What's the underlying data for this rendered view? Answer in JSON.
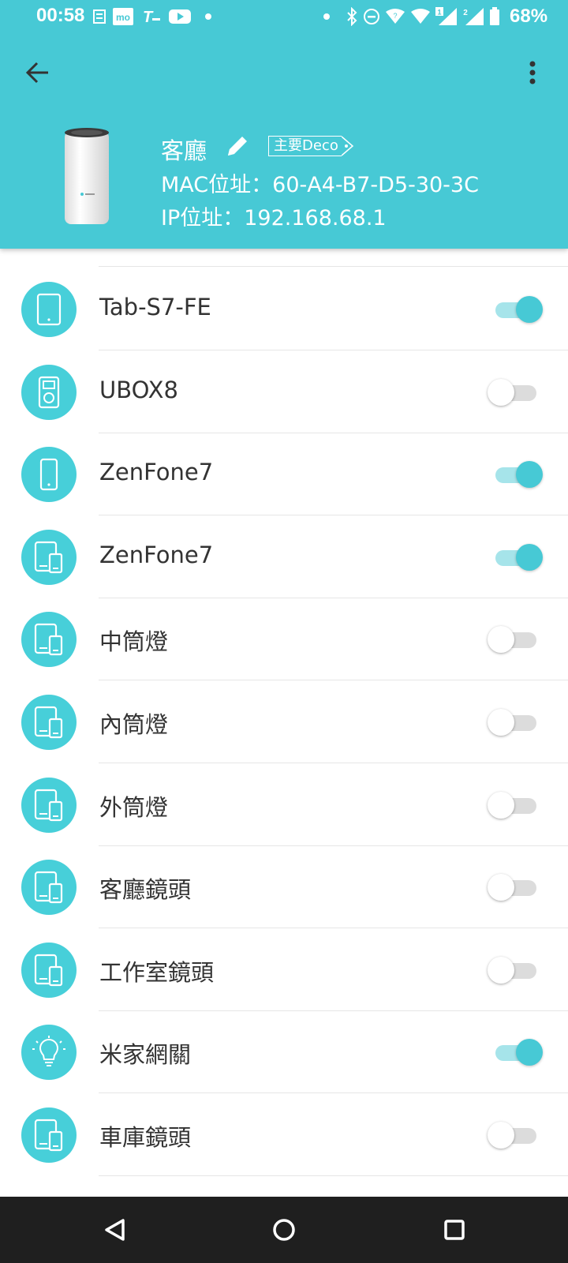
{
  "status_bar": {
    "time": "00:58",
    "battery_percent": "68%",
    "icons_left": [
      "notification-icon",
      "mo-app-icon",
      "t-app-icon",
      "youtube-icon"
    ],
    "icons_right": [
      "bluetooth-icon",
      "dnd-icon",
      "wifi-icon",
      "signal-sim1-icon",
      "signal-sim2-icon",
      "battery-icon"
    ]
  },
  "header": {
    "device_name": "客廳",
    "badge_label": "主要Deco",
    "mac": "MAC位址：60-A4-B7-D5-30-3C",
    "ip": "IP位址：192.168.68.1",
    "accent_color": "#47c9d5"
  },
  "devices": [
    {
      "name": "Tab-S7-FE",
      "icon": "tablet-icon",
      "enabled": true
    },
    {
      "name": "UBOX8",
      "icon": "media-box-icon",
      "enabled": false
    },
    {
      "name": "ZenFone7",
      "icon": "phone-icon",
      "enabled": true
    },
    {
      "name": "ZenFone7",
      "icon": "multi-device-icon",
      "enabled": true
    },
    {
      "name": "中筒燈",
      "icon": "multi-device-icon",
      "enabled": false
    },
    {
      "name": "內筒燈",
      "icon": "multi-device-icon",
      "enabled": false
    },
    {
      "name": "外筒燈",
      "icon": "multi-device-icon",
      "enabled": false
    },
    {
      "name": "客廳鏡頭",
      "icon": "multi-device-icon",
      "enabled": false
    },
    {
      "name": "工作室鏡頭",
      "icon": "multi-device-icon",
      "enabled": false
    },
    {
      "name": "米家網關",
      "icon": "lightbulb-icon",
      "enabled": true
    },
    {
      "name": "車庫鏡頭",
      "icon": "multi-device-icon",
      "enabled": false
    }
  ],
  "nav": {
    "items": [
      "back",
      "home",
      "recents"
    ]
  }
}
